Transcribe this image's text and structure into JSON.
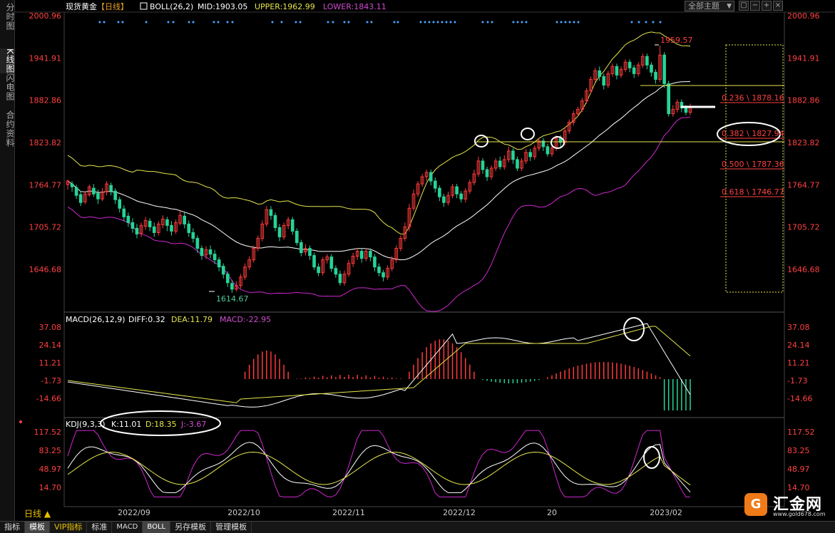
{
  "sidebar": {
    "tabs": [
      {
        "label": "分时图",
        "active": false
      },
      {
        "label": "K线图",
        "active": true
      },
      {
        "label": "闪电图",
        "active": false
      },
      {
        "label": "合约资料",
        "active": false
      }
    ]
  },
  "header": {
    "symbol": "现货黄金",
    "period": "【日线】",
    "boll_label": "BOLL(26,2)",
    "mid_label": "MID:1903.05",
    "upper_label": "UPPER:1962.99",
    "lower_label": "LOWER:1843.11",
    "theme_button": "全部主题",
    "theme_caret": "▼"
  },
  "macd_header": {
    "name": "MACD(26,12,9)",
    "diff": "DIFF:0.32",
    "dea": "DEA:11.79",
    "macd": "MACD:-22.95"
  },
  "kdj_header": {
    "name": "KDJ(9,3,3)",
    "k": "K:11.01",
    "d": "D:18.35",
    "j": "J:-3.67"
  },
  "bottom_tabs": [
    "指标",
    "模板",
    "VIP指标",
    "标准",
    "MACD",
    "BOLL",
    "另存模板",
    "管理模板"
  ],
  "period_button": "日线 ▲",
  "logo": {
    "name": "汇金网",
    "url": "www.gold678.com"
  },
  "colors": {
    "up": "#ff3b3b",
    "down": "#27d397",
    "mid": "#ffffff",
    "upper": "#e6e64d",
    "lower": "#d028d0",
    "axis_text": "#ff4040",
    "dea": "#e6e64d",
    "diff": "#ffffff"
  },
  "chart_data": [
    {
      "type": "candlestick",
      "title": "现货黄金【日线】",
      "y_ticks": [
        2000.96,
        1941.91,
        1882.86,
        1823.82,
        1764.77,
        1705.72,
        1646.68
      ],
      "y_tick_labels": [
        "2000.96",
        "1941.91",
        "1882.86",
        "1823.82",
        "1764.77",
        "1705.72",
        "1646.68"
      ],
      "x_tick_labels": [
        "2022/09",
        "2022/10",
        "2022/11",
        "2022/12",
        "20",
        "2023/02"
      ],
      "high_label": "1959.57",
      "low_label": "1614.67",
      "candles": [
        [
          1765,
          1770,
          1772,
          1758
        ],
        [
          1766,
          1762,
          1770,
          1755
        ],
        [
          1761,
          1750,
          1765,
          1745
        ],
        [
          1751,
          1740,
          1756,
          1735
        ],
        [
          1741,
          1752,
          1755,
          1738
        ],
        [
          1751,
          1762,
          1765,
          1748
        ],
        [
          1760,
          1752,
          1766,
          1748
        ],
        [
          1753,
          1745,
          1758,
          1738
        ],
        [
          1745,
          1755,
          1760,
          1742
        ],
        [
          1755,
          1766,
          1770,
          1750
        ],
        [
          1764,
          1756,
          1768,
          1750
        ],
        [
          1756,
          1744,
          1760,
          1738
        ],
        [
          1744,
          1732,
          1748,
          1726
        ],
        [
          1731,
          1720,
          1736,
          1714
        ],
        [
          1721,
          1712,
          1726,
          1706
        ],
        [
          1712,
          1704,
          1718,
          1698
        ],
        [
          1704,
          1696,
          1710,
          1690
        ],
        [
          1697,
          1708,
          1712,
          1692
        ],
        [
          1707,
          1715,
          1720,
          1702
        ],
        [
          1714,
          1706,
          1718,
          1700
        ],
        [
          1706,
          1698,
          1712,
          1692
        ],
        [
          1698,
          1710,
          1714,
          1694
        ],
        [
          1709,
          1717,
          1722,
          1704
        ],
        [
          1716,
          1708,
          1720,
          1700
        ],
        [
          1708,
          1700,
          1714,
          1694
        ],
        [
          1700,
          1712,
          1716,
          1696
        ],
        [
          1711,
          1722,
          1728,
          1708
        ],
        [
          1721,
          1710,
          1726,
          1704
        ],
        [
          1710,
          1698,
          1715,
          1692
        ],
        [
          1698,
          1690,
          1704,
          1684
        ],
        [
          1690,
          1676,
          1694,
          1670
        ],
        [
          1676,
          1666,
          1680,
          1660
        ],
        [
          1667,
          1674,
          1679,
          1661
        ],
        [
          1674,
          1668,
          1680,
          1662
        ],
        [
          1668,
          1660,
          1674,
          1654
        ],
        [
          1660,
          1650,
          1664,
          1644
        ],
        [
          1651,
          1640,
          1655,
          1634
        ],
        [
          1640,
          1628,
          1644,
          1622
        ],
        [
          1627,
          1619,
          1632,
          1614
        ],
        [
          1619,
          1624,
          1630,
          1616
        ],
        [
          1624,
          1636,
          1640,
          1620
        ],
        [
          1636,
          1650,
          1655,
          1632
        ],
        [
          1650,
          1660,
          1665,
          1646
        ],
        [
          1660,
          1676,
          1680,
          1656
        ],
        [
          1676,
          1690,
          1694,
          1672
        ],
        [
          1690,
          1710,
          1715,
          1686
        ],
        [
          1710,
          1730,
          1735,
          1706
        ],
        [
          1730,
          1722,
          1735,
          1716
        ],
        [
          1722,
          1705,
          1726,
          1700
        ],
        [
          1705,
          1692,
          1710,
          1686
        ],
        [
          1692,
          1708,
          1712,
          1688
        ],
        [
          1708,
          1716,
          1720,
          1703
        ],
        [
          1716,
          1700,
          1720,
          1695
        ],
        [
          1700,
          1684,
          1704,
          1680
        ],
        [
          1684,
          1670,
          1688,
          1665
        ],
        [
          1671,
          1676,
          1682,
          1666
        ],
        [
          1676,
          1666,
          1680,
          1660
        ],
        [
          1666,
          1650,
          1670,
          1646
        ],
        [
          1650,
          1642,
          1655,
          1637
        ],
        [
          1642,
          1660,
          1664,
          1638
        ],
        [
          1660,
          1664,
          1668,
          1655
        ],
        [
          1664,
          1648,
          1668,
          1643
        ],
        [
          1648,
          1640,
          1652,
          1635
        ],
        [
          1640,
          1628,
          1645,
          1624
        ],
        [
          1628,
          1640,
          1645,
          1624
        ],
        [
          1640,
          1655,
          1660,
          1636
        ],
        [
          1655,
          1665,
          1670,
          1650
        ],
        [
          1665,
          1672,
          1676,
          1660
        ],
        [
          1672,
          1662,
          1676,
          1656
        ],
        [
          1662,
          1672,
          1676,
          1658
        ],
        [
          1672,
          1664,
          1676,
          1658
        ],
        [
          1664,
          1650,
          1668,
          1644
        ],
        [
          1650,
          1642,
          1655,
          1637
        ],
        [
          1642,
          1636,
          1646,
          1630
        ],
        [
          1636,
          1648,
          1652,
          1632
        ],
        [
          1648,
          1660,
          1665,
          1644
        ],
        [
          1660,
          1676,
          1680,
          1656
        ],
        [
          1676,
          1690,
          1694,
          1672
        ],
        [
          1690,
          1706,
          1712,
          1686
        ],
        [
          1706,
          1732,
          1738,
          1700
        ],
        [
          1732,
          1752,
          1758,
          1728
        ],
        [
          1752,
          1766,
          1770,
          1748
        ],
        [
          1766,
          1776,
          1780,
          1762
        ],
        [
          1776,
          1782,
          1786,
          1770
        ],
        [
          1782,
          1770,
          1786,
          1764
        ],
        [
          1770,
          1760,
          1775,
          1754
        ],
        [
          1760,
          1748,
          1764,
          1742
        ],
        [
          1748,
          1740,
          1752,
          1734
        ],
        [
          1740,
          1750,
          1755,
          1736
        ],
        [
          1750,
          1762,
          1766,
          1746
        ],
        [
          1762,
          1752,
          1766,
          1746
        ],
        [
          1752,
          1745,
          1756,
          1740
        ],
        [
          1745,
          1756,
          1760,
          1740
        ],
        [
          1756,
          1768,
          1772,
          1752
        ],
        [
          1768,
          1780,
          1786,
          1764
        ],
        [
          1780,
          1798,
          1804,
          1776
        ],
        [
          1798,
          1786,
          1802,
          1780
        ],
        [
          1786,
          1776,
          1790,
          1770
        ],
        [
          1776,
          1788,
          1792,
          1772
        ],
        [
          1788,
          1798,
          1802,
          1784
        ],
        [
          1798,
          1790,
          1804,
          1786
        ],
        [
          1790,
          1800,
          1806,
          1786
        ],
        [
          1800,
          1812,
          1818,
          1796
        ],
        [
          1812,
          1800,
          1816,
          1794
        ],
        [
          1800,
          1788,
          1804,
          1784
        ],
        [
          1788,
          1798,
          1802,
          1784
        ],
        [
          1798,
          1810,
          1815,
          1794
        ],
        [
          1810,
          1804,
          1815,
          1798
        ],
        [
          1804,
          1816,
          1820,
          1800
        ],
        [
          1816,
          1826,
          1830,
          1812
        ],
        [
          1826,
          1818,
          1830,
          1812
        ],
        [
          1818,
          1808,
          1822,
          1804
        ],
        [
          1808,
          1816,
          1820,
          1804
        ],
        [
          1816,
          1830,
          1834,
          1812
        ],
        [
          1830,
          1824,
          1834,
          1818
        ],
        [
          1824,
          1840,
          1845,
          1820
        ],
        [
          1840,
          1852,
          1856,
          1836
        ],
        [
          1852,
          1864,
          1868,
          1848
        ],
        [
          1864,
          1870,
          1874,
          1860
        ],
        [
          1870,
          1882,
          1886,
          1866
        ],
        [
          1882,
          1896,
          1900,
          1878
        ],
        [
          1896,
          1912,
          1916,
          1892
        ],
        [
          1912,
          1924,
          1928,
          1908
        ],
        [
          1924,
          1916,
          1930,
          1910
        ],
        [
          1916,
          1904,
          1920,
          1898
        ],
        [
          1904,
          1920,
          1924,
          1900
        ],
        [
          1920,
          1930,
          1934,
          1916
        ],
        [
          1930,
          1918,
          1934,
          1912
        ],
        [
          1918,
          1926,
          1930,
          1914
        ],
        [
          1926,
          1936,
          1940,
          1922
        ],
        [
          1936,
          1928,
          1940,
          1922
        ],
        [
          1928,
          1920,
          1932,
          1914
        ],
        [
          1920,
          1932,
          1936,
          1916
        ],
        [
          1932,
          1944,
          1948,
          1928
        ],
        [
          1944,
          1932,
          1948,
          1926
        ],
        [
          1932,
          1922,
          1936,
          1916
        ],
        [
          1922,
          1912,
          1926,
          1906
        ],
        [
          1912,
          1946,
          1959,
          1908
        ],
        [
          1946,
          1906,
          1950,
          1900
        ],
        [
          1906,
          1864,
          1910,
          1860
        ],
        [
          1864,
          1870,
          1876,
          1860
        ],
        [
          1870,
          1880,
          1884,
          1866
        ],
        [
          1880,
          1872,
          1884,
          1866
        ],
        [
          1872,
          1866,
          1876,
          1862
        ],
        [
          1866,
          1874,
          1878,
          1862
        ]
      ],
      "fibonacci_levels": [
        {
          "ratio": "0.236",
          "price": "1878.16"
        },
        {
          "ratio": "0.382",
          "price": "1827.94"
        },
        {
          "ratio": "0.500",
          "price": "1787.36"
        },
        {
          "ratio": "0.618",
          "price": "1746.77"
        }
      ],
      "fib_labels": [
        "0.236 \\ 1878.16",
        "0.382 \\ 1827.94",
        "0.500 \\ 1787.36",
        "0.618 \\ 1746.77"
      ]
    },
    {
      "type": "bar",
      "title": "MACD(26,12,9)",
      "y_tick_labels": [
        "37.08",
        "24.14",
        "11.21",
        "-1.73",
        "-14.66"
      ],
      "y_ticks": [
        37.08,
        24.14,
        11.21,
        -1.73,
        -14.66
      ]
    },
    {
      "type": "line",
      "title": "KDJ(9,3,3)",
      "y_tick_labels": [
        "117.52",
        "83.25",
        "48.97",
        "14.70"
      ],
      "y_ticks": [
        117.52,
        83.25,
        48.97,
        14.7
      ]
    }
  ]
}
